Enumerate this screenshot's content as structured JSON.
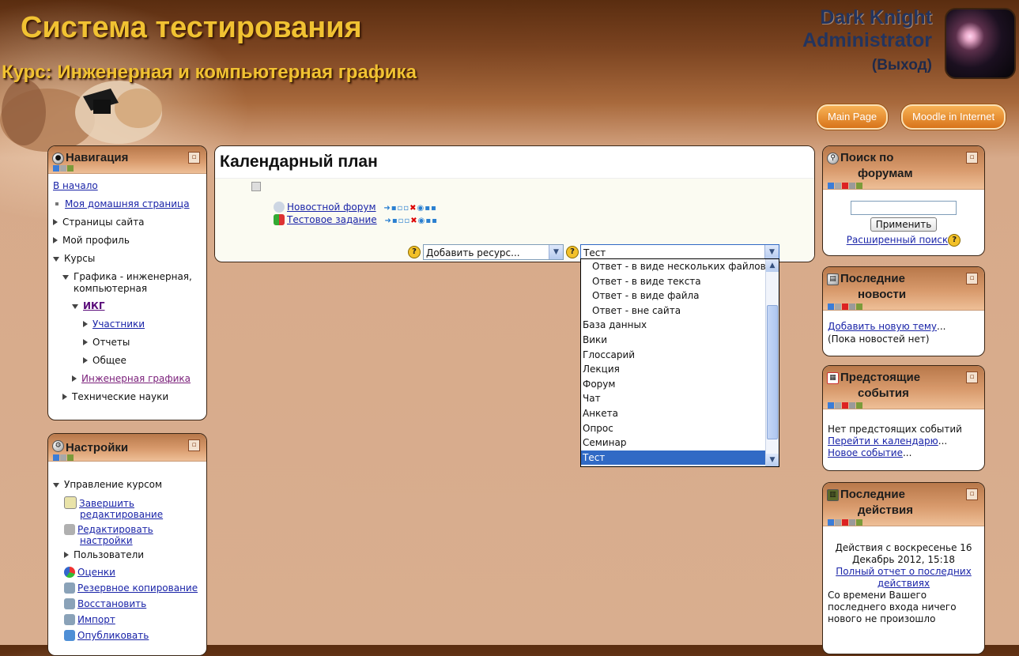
{
  "header": {
    "site_title": "Система тестирования",
    "course_title": "Курс: Инженерная и компьютерная графика",
    "user_name": "Dark Knight",
    "user_role": "Administrator",
    "logout": "(Выход)",
    "buttons": [
      "Main Page",
      "Moodle in Internet"
    ]
  },
  "navigation": {
    "title": "Навигация",
    "home": "В начало",
    "my_home": "Моя домашняя страница",
    "site_pages": "Страницы сайта",
    "my_profile": "Мой профиль",
    "courses": "Курсы",
    "category": "Графика - инженерная,",
    "category2": "компьютерная",
    "course_short": "ИКГ",
    "participants": "Участники",
    "reports": "Отчеты",
    "general": "Общее",
    "eng_graphics": "Инженерная графика",
    "tech_sciences": "Технические науки"
  },
  "settings": {
    "title": "Настройки",
    "course_admin": "Управление курсом",
    "finish_editing_1": "Завершить",
    "finish_editing_2": "редактирование",
    "edit_settings_1": "Редактировать",
    "edit_settings_2": "настройки",
    "users": "Пользователи",
    "grades": "Оценки",
    "backup": "Резервное копирование",
    "restore": "Восстановить",
    "import": "Импорт",
    "publish": "Опубликовать"
  },
  "main": {
    "title": "Календарный план",
    "activities": [
      "Новостной форум",
      "Тестовое задание"
    ],
    "add_resource": "Добавить ресурс...",
    "add_activity": "Тест"
  },
  "activity_dropdown": {
    "items": [
      {
        "label": "Ответ - в виде нескольких файлов",
        "sub": true
      },
      {
        "label": "Ответ - в виде текста",
        "sub": true
      },
      {
        "label": "Ответ - в виде файла",
        "sub": true
      },
      {
        "label": "Ответ - вне сайта",
        "sub": true
      },
      {
        "label": "База данных",
        "sub": false
      },
      {
        "label": "Вики",
        "sub": false
      },
      {
        "label": "Глоссарий",
        "sub": false
      },
      {
        "label": "Лекция",
        "sub": false
      },
      {
        "label": "Форум",
        "sub": false
      },
      {
        "label": "Чат",
        "sub": false
      },
      {
        "label": "Анкета",
        "sub": false
      },
      {
        "label": "Опрос",
        "sub": false
      },
      {
        "label": "Семинар",
        "sub": false
      },
      {
        "label": "Тест",
        "sub": false,
        "selected": true
      }
    ]
  },
  "search_forums": {
    "title_1": "Поиск по",
    "title_2": "форумам",
    "apply": "Применить",
    "advanced": "Расширенный поиск"
  },
  "latest_news": {
    "title_1": "Последние",
    "title_2": "новости",
    "add_topic": "Добавить новую тему",
    "ellipsis": "...",
    "no_news": "(Пока новостей нет)"
  },
  "upcoming": {
    "title_1": "Предстоящие",
    "title_2": "события",
    "none": "Нет предстоящих событий",
    "goto_calendar": "Перейти к календарю",
    "ellipsis1": "...",
    "new_event": "Новое событие",
    "ellipsis2": "..."
  },
  "recent": {
    "title_1": "Последние",
    "title_2": "действия",
    "since_1": "Действия с воскресенье 16",
    "since_2": "Декабрь 2012, 15:18",
    "full_report_1": "Полный отчет о последних",
    "full_report_2": "действиях",
    "nothing": "Со времени Вашего последнего входа ничего нового не произошло"
  }
}
